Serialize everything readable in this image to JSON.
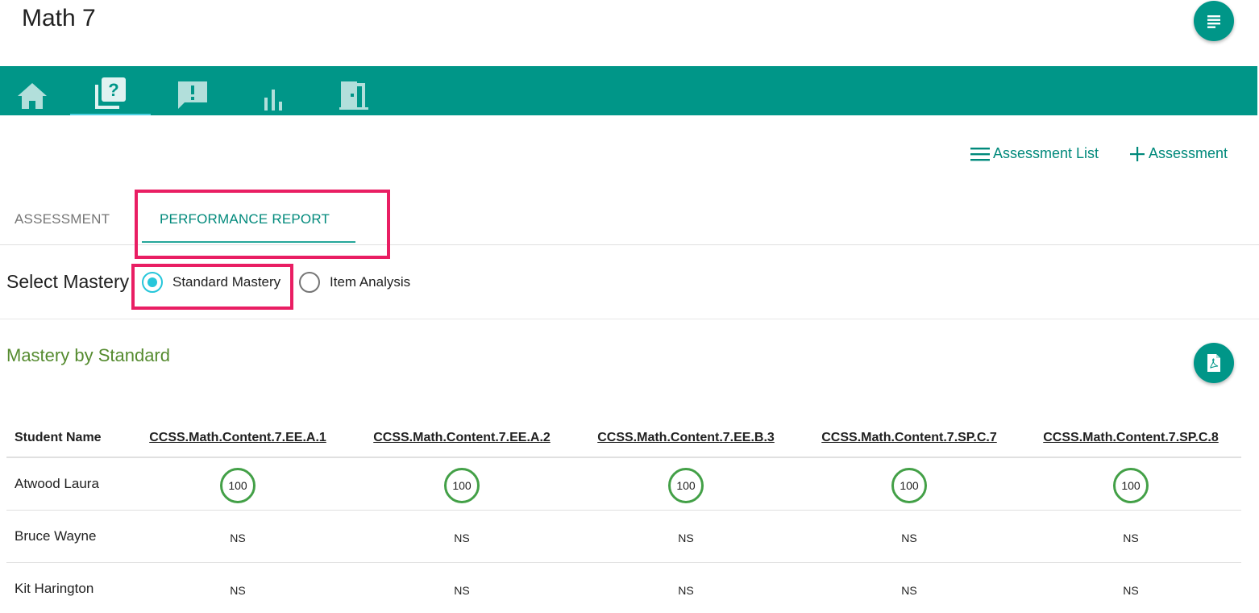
{
  "header": {
    "title": "Math 7"
  },
  "nav": {
    "items": [
      {
        "name": "home",
        "icon": "home-icon"
      },
      {
        "name": "assessment",
        "icon": "quiz-icon",
        "active": true
      },
      {
        "name": "feedback",
        "icon": "feedback-icon"
      },
      {
        "name": "reports",
        "icon": "bar-chart-icon"
      },
      {
        "name": "exit",
        "icon": "door-exit-icon"
      }
    ]
  },
  "actions": {
    "assessment_list": "Assessment List",
    "add_assessment": "Assessment"
  },
  "tabs": {
    "assessment": "ASSESSMENT",
    "performance_report": "PERFORMANCE REPORT",
    "active": "performance_report"
  },
  "mastery": {
    "label": "Select Mastery",
    "options": [
      "Standard Mastery",
      "Item Analysis"
    ],
    "selected": "Standard Mastery"
  },
  "section": {
    "title": "Mastery by Standard"
  },
  "table": {
    "columns": [
      "Student Name",
      "CCSS.Math.Content.7.EE.A.1",
      "CCSS.Math.Content.7.EE.A.2",
      "CCSS.Math.Content.7.EE.B.3",
      "CCSS.Math.Content.7.SP.C.7",
      "CCSS.Math.Content.7.SP.C.8"
    ],
    "rows": [
      {
        "name": "Atwood Laura",
        "scores": [
          "100",
          "100",
          "100",
          "100",
          "100"
        ]
      },
      {
        "name": "Bruce Wayne",
        "scores": [
          "NS",
          "NS",
          "NS",
          "NS",
          "NS"
        ]
      },
      {
        "name": "Kit Harington",
        "scores": [
          "NS",
          "NS",
          "NS",
          "NS",
          "NS"
        ]
      }
    ]
  },
  "colors": {
    "primary": "#009688",
    "accent_link": "#00897b",
    "highlight": "#e91e63",
    "score_ring": "#43a047",
    "section_title": "#558b2f",
    "radio": "#26c6da"
  }
}
